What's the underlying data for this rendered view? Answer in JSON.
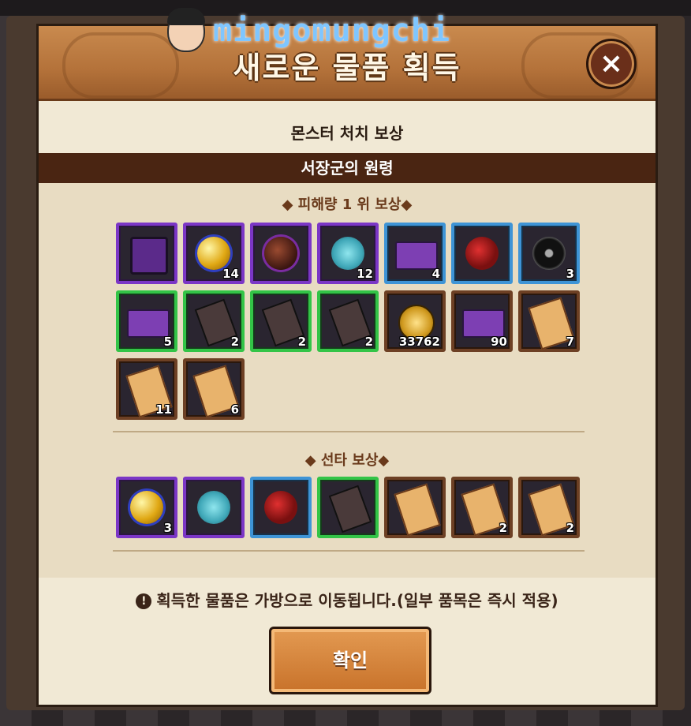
{
  "watermark": {
    "text": "mingomungchi"
  },
  "dialog": {
    "title": "새로운 물품 획득",
    "subtitle": "몬스터 처치 보상",
    "boss_name": "서장군의 원령",
    "section1_title": "◆ 피해량 1 위 보상◆",
    "section2_title": "◆ 선타 보상◆",
    "notice": "획득한 물품은 가방으로 이동됩니다.(일부 품목은 즉시 적용)",
    "notice_icon": "!",
    "confirm_label": "확인",
    "close_icon": "×"
  },
  "section1_items": [
    {
      "name": "purple-chest",
      "rarity": "purple",
      "qty": ""
    },
    {
      "name": "gold-orb",
      "rarity": "purple",
      "qty": "14"
    },
    {
      "name": "dark-orb",
      "rarity": "purple",
      "qty": ""
    },
    {
      "name": "cyan-coin",
      "rarity": "purple",
      "qty": "12"
    },
    {
      "name": "purple-box",
      "rarity": "blue",
      "qty": "4"
    },
    {
      "name": "red-cloud",
      "rarity": "blue",
      "qty": ""
    },
    {
      "name": "black-ring",
      "rarity": "blue",
      "qty": "3"
    },
    {
      "name": "purple-box",
      "rarity": "green",
      "qty": "5"
    },
    {
      "name": "card-dagger",
      "rarity": "green",
      "qty": "2"
    },
    {
      "name": "card-bone",
      "rarity": "green",
      "qty": "2"
    },
    {
      "name": "card-ring",
      "rarity": "green",
      "qty": "2"
    },
    {
      "name": "gold-coin",
      "rarity": "brown",
      "qty": "33762"
    },
    {
      "name": "purple-box",
      "rarity": "brown",
      "qty": "90"
    },
    {
      "name": "scroll-dagger",
      "rarity": "brown",
      "qty": "7"
    },
    {
      "name": "scroll-shirt",
      "rarity": "brown",
      "qty": "11"
    },
    {
      "name": "scroll-ring",
      "rarity": "brown",
      "qty": "6"
    }
  ],
  "section2_items": [
    {
      "name": "gold-orb",
      "rarity": "purple",
      "qty": "3"
    },
    {
      "name": "cyan-coin",
      "rarity": "purple",
      "qty": ""
    },
    {
      "name": "red-cloud",
      "rarity": "blue",
      "qty": ""
    },
    {
      "name": "card-bone",
      "rarity": "green",
      "qty": ""
    },
    {
      "name": "scroll-dagger",
      "rarity": "brown",
      "qty": ""
    },
    {
      "name": "scroll-shirt",
      "rarity": "brown",
      "qty": "2"
    },
    {
      "name": "scroll-ring",
      "rarity": "brown",
      "qty": "2"
    }
  ]
}
